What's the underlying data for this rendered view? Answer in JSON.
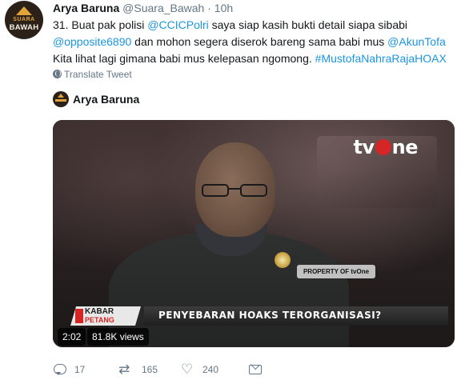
{
  "tweet": {
    "author_name": "Arya Baruna",
    "author_handle": "@Suara_Bawah",
    "separator": "·",
    "time": "10h",
    "avatar": {
      "line1": "SUARA",
      "line2": "BAWAH",
      "icon": "house-logo"
    },
    "text": {
      "row1_a": "31. Buat pak polisi ",
      "row1_mention": "@CCICPolri",
      "row1_b": " saya siap kasih bukti detail siapa sibabi",
      "row2_mention1": "@opposite6890",
      "row2_b": " dan mohon segera diserok bareng sama babi mus ",
      "row2_mention2": "@AkunTofa",
      "row3_a": "Kita lihat lagi gimana babi mus kelepasan ngomong. ",
      "row3_hashtag": "#MustofaNahraRajaHOAX"
    },
    "translate_label": "Translate Tweet",
    "translate_icon": "globe-icon"
  },
  "card": {
    "author_name": "Arya Baruna"
  },
  "video": {
    "channel_logo_left": "tv",
    "channel_logo_right": "ne",
    "property_text": "PROPERTY OF tvOne",
    "program_line1": "KABAR",
    "program_line2": "PETANG",
    "headline": "PENYEBARAN HOAKS TERORGANISASI?",
    "duration": "2:02",
    "views": "81.8K views"
  },
  "actions": {
    "reply_count": "17",
    "retweet_count": "165",
    "like_count": "240",
    "reply_icon": "reply-icon",
    "retweet_icon": "retweet-icon",
    "like_icon": "heart-icon",
    "dm_icon": "envelope-icon"
  },
  "colors": {
    "link": "#1b95e0",
    "muted": "#657786",
    "text": "#14171a",
    "tvone_red": "#d62525"
  }
}
